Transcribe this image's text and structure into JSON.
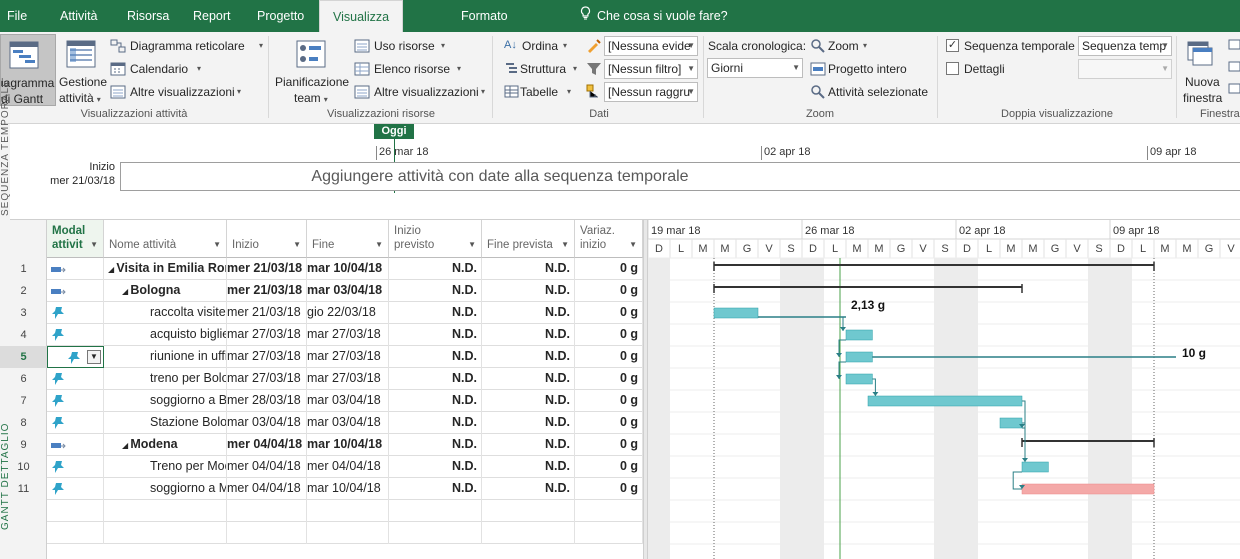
{
  "tabs": {
    "file": "File",
    "attivita": "Attività",
    "risorsa": "Risorsa",
    "report": "Report",
    "progetto": "Progetto",
    "visualizza": "Visualizza",
    "formato": "Formato",
    "tell_me": "Che cosa si vuole fare?"
  },
  "ribbon": {
    "task_views": {
      "gantt_line1": "iagramma",
      "gantt_line2": "di Gantt",
      "gestione_line1": "Gestione",
      "gestione_line2": "attività",
      "diagramma_reticolare": "Diagramma reticolare",
      "calendario": "Calendario",
      "altre_visualizzazioni": "Altre visualizzazioni",
      "group_label": "Visualizzazioni attività"
    },
    "resource_views": {
      "pianificazione_line1": "Pianificazione",
      "pianificazione_line2": "team",
      "uso_risorse": "Uso risorse",
      "elenco_risorse": "Elenco risorse",
      "altre_visualizzazioni": "Altre visualizzazioni",
      "group_label": "Visualizzazioni risorse"
    },
    "data": {
      "ordina": "Ordina",
      "struttura": "Struttura",
      "tabelle": "Tabelle",
      "evidenziazione": "[Nessuna evide",
      "filtro": "[Nessun filtro]",
      "raggruppamento": "[Nessun raggru",
      "group_label": "Dati"
    },
    "zoom": {
      "scala_label": "Scala cronologica:",
      "scala_value": "Giorni",
      "zoom": "Zoom",
      "progetto_intero": "Progetto intero",
      "attivita_selezionate": "Attività selezionate",
      "group_label": "Zoom"
    },
    "split_view": {
      "sequenza_temporale": "Sequenza temporale",
      "sequenza_checked": true,
      "dettagli": "Dettagli",
      "dettagli_checked": false,
      "sequenza_combo": "Sequenza temp",
      "details_combo": "",
      "group_label": "Doppia visualizzazione"
    },
    "window": {
      "nuova_line1": "Nuova",
      "nuova_line2": "finestra",
      "group_label": "Finestra"
    }
  },
  "timeline": {
    "side_label": "SEQUENZA TEMPORALE",
    "today_flag": "Oggi",
    "start_label": "Inizio",
    "start_date": "mer 21/03/18",
    "ticks": [
      "26 mar 18",
      "02 apr 18",
      "09 apr 18"
    ],
    "hint": "Aggiungere attività con date alla sequenza temporale"
  },
  "grid": {
    "side_label": "GANTT DETTAGLIO",
    "columns": {
      "mode": "Modal attivit",
      "name": "Nome attività",
      "start": "Inizio",
      "finish": "Fine",
      "baseline_start": "Inizio previsto",
      "baseline_finish": "Fine prevista",
      "start_variance": "Variaz. inizio"
    },
    "rows": [
      {
        "id": "1",
        "name": "Visita in Emilia Romagna",
        "start": "mer 21/03/18",
        "finish": "mar 10/04/18",
        "bstart": "N.D.",
        "bfinish": "N.D.",
        "var": "0 g",
        "level": 0,
        "summary": true
      },
      {
        "id": "2",
        "name": "Bologna",
        "start": "mer 21/03/18",
        "finish": "mar 03/04/18",
        "bstart": "N.D.",
        "bfinish": "N.D.",
        "var": "0 g",
        "level": 1,
        "summary": true
      },
      {
        "id": "3",
        "name": "raccolta visite",
        "start": "mer 21/03/18",
        "finish": "gio 22/03/18",
        "bstart": "N.D.",
        "bfinish": "N.D.",
        "var": "0 g",
        "level": 2,
        "summary": false
      },
      {
        "id": "4",
        "name": "acquisto biglietti",
        "start": "mar 27/03/18",
        "finish": "mar 27/03/18",
        "bstart": "N.D.",
        "bfinish": "N.D.",
        "var": "0 g",
        "level": 2,
        "summary": false
      },
      {
        "id": "5",
        "name": "riunione in ufficio",
        "start": "mar 27/03/18",
        "finish": "mar 27/03/18",
        "bstart": "N.D.",
        "bfinish": "N.D.",
        "var": "0 g",
        "level": 2,
        "summary": false
      },
      {
        "id": "6",
        "name": "treno per Bologna",
        "start": "mar 27/03/18",
        "finish": "mar 27/03/18",
        "bstart": "N.D.",
        "bfinish": "N.D.",
        "var": "0 g",
        "level": 2,
        "summary": false
      },
      {
        "id": "7",
        "name": "soggiorno a Bologna",
        "start": "mer 28/03/18",
        "finish": "mar 03/04/18",
        "bstart": "N.D.",
        "bfinish": "N.D.",
        "var": "0 g",
        "level": 2,
        "summary": false
      },
      {
        "id": "8",
        "name": "Stazione Bologna",
        "start": "mar 03/04/18",
        "finish": "mar 03/04/18",
        "bstart": "N.D.",
        "bfinish": "N.D.",
        "var": "0 g",
        "level": 2,
        "summary": false
      },
      {
        "id": "9",
        "name": "Modena",
        "start": "mer 04/04/18",
        "finish": "mar 10/04/18",
        "bstart": "N.D.",
        "bfinish": "N.D.",
        "var": "0 g",
        "level": 1,
        "summary": true
      },
      {
        "id": "10",
        "name": "Treno per Modena",
        "start": "mer 04/04/18",
        "finish": "mer 04/04/18",
        "bstart": "N.D.",
        "bfinish": "N.D.",
        "var": "0 g",
        "level": 2,
        "summary": false
      },
      {
        "id": "11",
        "name": "soggiorno a Modena",
        "start": "mer 04/04/18",
        "finish": "mar 10/04/18",
        "bstart": "N.D.",
        "bfinish": "N.D.",
        "var": "0 g",
        "level": 2,
        "summary": false
      }
    ],
    "selected_row": "5"
  },
  "gantt": {
    "weeks": [
      "19 mar 18",
      "26 mar 18",
      "02 apr 18",
      "09 apr 18"
    ],
    "day_letters": [
      "D",
      "L",
      "M",
      "M",
      "G",
      "V",
      "S",
      "D",
      "L",
      "M",
      "M",
      "G",
      "V",
      "S",
      "D",
      "L",
      "M",
      "M",
      "G",
      "V",
      "S",
      "D",
      "L",
      "M",
      "M",
      "G",
      "V",
      "S"
    ],
    "labels": {
      "slack_3": "2,13 g",
      "slack_5": "10 g"
    },
    "colors": {
      "task": "#6fc8cf",
      "task_border": "#2aa0a8",
      "critical": "#f4a9a8",
      "summary": "#333333",
      "link": "#2a7f86",
      "today": "#4aa04a",
      "weekend": "#ececec"
    }
  }
}
